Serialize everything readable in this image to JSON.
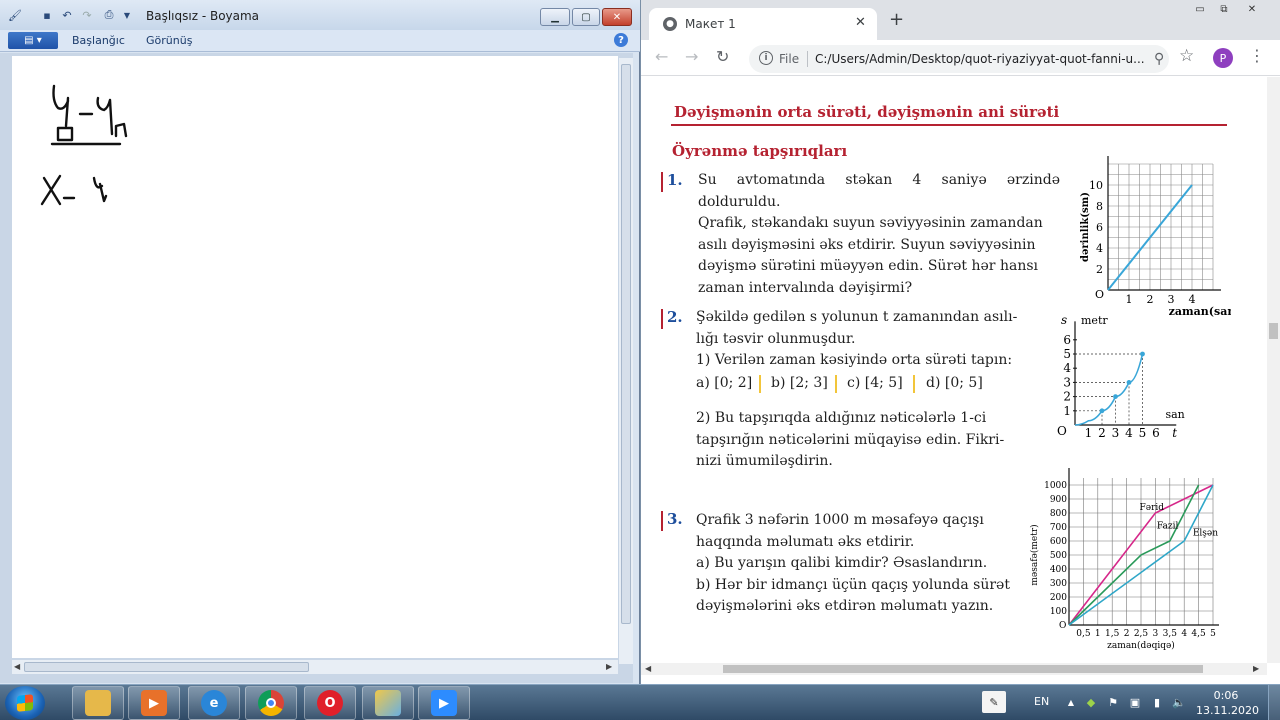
{
  "paint": {
    "title": "Başlıqsız - Boyama",
    "tabs": [
      "Başlanğıc",
      "Görünüş"
    ],
    "help": "?"
  },
  "chrome": {
    "tab_title": "Макет 1",
    "file_label": "File",
    "url": "C:/Users/Admin/Desktop/quot-riyaziyyat-quot-fanni-u...",
    "profile_initial": "P"
  },
  "doc": {
    "section_title": "Dəyişmənin orta sürəti, dəyişmənin ani sürəti",
    "subsection": "Öyrənmə tapşırıqları",
    "q1": {
      "num": "1.",
      "lines": [
        "Su avtomatında stəkan 4 saniyə ərzində dolduruldu.",
        "Qrafik, stəkandakı suyun səviyyəsinin zamandan",
        "asılı dəyişməsini əks etdirir. Suyun səviyyəsinin",
        "dəyişmə sürətini müəyyən edin.  Sürət hər hansı",
        "zaman intervalında dəyişirmi?"
      ]
    },
    "q2": {
      "num": "2.",
      "lines": [
        "Şəkildə gedilən s yolunun t zamanından asılı-",
        "lığı təsvir olunmuşdur.",
        "1) Verilən zaman kəsiyində orta sürəti tapın:"
      ],
      "intervals": [
        "a) [0; 2]",
        "b) [2; 3]",
        "c) [4; 5]",
        "d) [0; 5]"
      ],
      "lines2": [
        "2) Bu tapşırıqda aldığınız nəticələrlə 1-ci",
        "tapşırığın nəticələrini müqayisə edin. Fikri-",
        "nizi ümumiləşdirin."
      ]
    },
    "q3": {
      "num": "3.",
      "lines": [
        "Qrafik 3 nəfərin 1000 m məsafəyə qaçışı",
        "haqqında məlumatı əks etdirir.",
        "a) Bu yarışın qalibi kimdir? Əsaslandırın.",
        "b) Hər bir idmançı üçün qaçış yolunda sürət",
        "dəyişmələrini əks etdirən məlumatı  yazın."
      ]
    }
  },
  "chart_data": [
    {
      "type": "line",
      "xlabel": "zaman(san)",
      "ylabel": "dərinlik(sm)",
      "origin": "O",
      "x_ticks": [
        1,
        2,
        3,
        4
      ],
      "y_ticks": [
        2,
        4,
        6,
        8,
        10
      ],
      "xlim": [
        0,
        5
      ],
      "ylim": [
        0,
        12
      ],
      "grid": true,
      "color": "#39a6d8",
      "series": [
        {
          "x": [
            0,
            4
          ],
          "y": [
            0,
            10
          ]
        }
      ]
    },
    {
      "type": "line",
      "xlabel": "san",
      "ylabel": "metr",
      "x_axis_letter": "t",
      "y_axis_letter": "s",
      "origin": "O",
      "x_ticks": [
        1,
        2,
        3,
        4,
        5,
        6
      ],
      "y_ticks": [
        1,
        2,
        3,
        4,
        5,
        6
      ],
      "xlim": [
        0,
        7
      ],
      "ylim": [
        0,
        7
      ],
      "grid": false,
      "color": "#39a6d8",
      "series": [
        {
          "x": [
            0,
            1,
            2,
            3,
            4,
            5
          ],
          "y": [
            0,
            0.3,
            1,
            2,
            3,
            5
          ],
          "points": [
            [
              2,
              1
            ],
            [
              3,
              2
            ],
            [
              4,
              3
            ],
            [
              5,
              5
            ]
          ]
        }
      ]
    },
    {
      "type": "line",
      "xlabel": "zaman(dəqiqə)",
      "ylabel": "məsafə(metr)",
      "origin": "O",
      "x_ticks": [
        "0,5",
        "1",
        "1,5",
        "2",
        "2,5",
        "3",
        "3,5",
        "4",
        "4,5",
        "5"
      ],
      "y_ticks": [
        100,
        200,
        300,
        400,
        500,
        600,
        700,
        800,
        900,
        1000
      ],
      "xlim": [
        0,
        5
      ],
      "ylim": [
        0,
        1050
      ],
      "grid": true,
      "series": [
        {
          "name": "Fərid",
          "color": "#d6288a",
          "x": [
            0,
            3,
            5
          ],
          "y": [
            0,
            800,
            1000
          ]
        },
        {
          "name": "Fazil",
          "color": "#2a9a5a",
          "x": [
            0,
            2.5,
            3.5,
            4.5
          ],
          "y": [
            0,
            500,
            600,
            1000
          ]
        },
        {
          "name": "Elşən",
          "color": "#2fa7c8",
          "x": [
            0,
            4,
            5
          ],
          "y": [
            0,
            600,
            1000
          ]
        }
      ]
    }
  ],
  "taskbar": {
    "lang": "EN",
    "time": "0:06",
    "date": "13.11.2020"
  }
}
